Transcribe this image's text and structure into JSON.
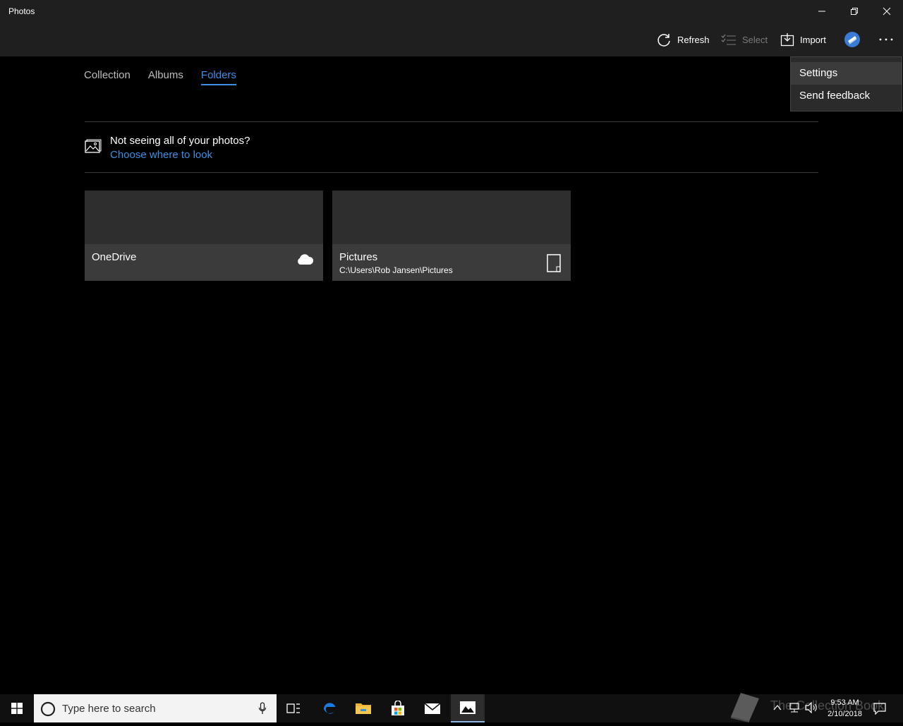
{
  "window": {
    "title": "Photos",
    "controls": {
      "minimize": "minimize",
      "restore": "restore",
      "close": "close"
    }
  },
  "toolbar": {
    "refresh_label": "Refresh",
    "select_label": "Select",
    "import_label": "Import"
  },
  "tabs": [
    {
      "label": "Collection",
      "active": false
    },
    {
      "label": "Albums",
      "active": false
    },
    {
      "label": "Folders",
      "active": true
    }
  ],
  "notice": {
    "title": "Not seeing all of your photos?",
    "link": "Choose where to look"
  },
  "folders": [
    {
      "name": "OneDrive",
      "path": "",
      "icon": "cloud-icon"
    },
    {
      "name": "Pictures",
      "path": "C:\\Users\\Rob Jansen\\Pictures",
      "icon": "device-icon"
    }
  ],
  "more_menu": {
    "items": [
      {
        "label": "Settings"
      },
      {
        "label": "Send feedback"
      }
    ]
  },
  "taskbar": {
    "search_placeholder": "Type here to search",
    "time": "9:53 AM",
    "date": "2/10/2018",
    "watermark": "The Collection Book"
  },
  "colors": {
    "accent": "#3d8ee4",
    "titlebar": "#1f1f1f",
    "tile": "#2e2e2e"
  }
}
